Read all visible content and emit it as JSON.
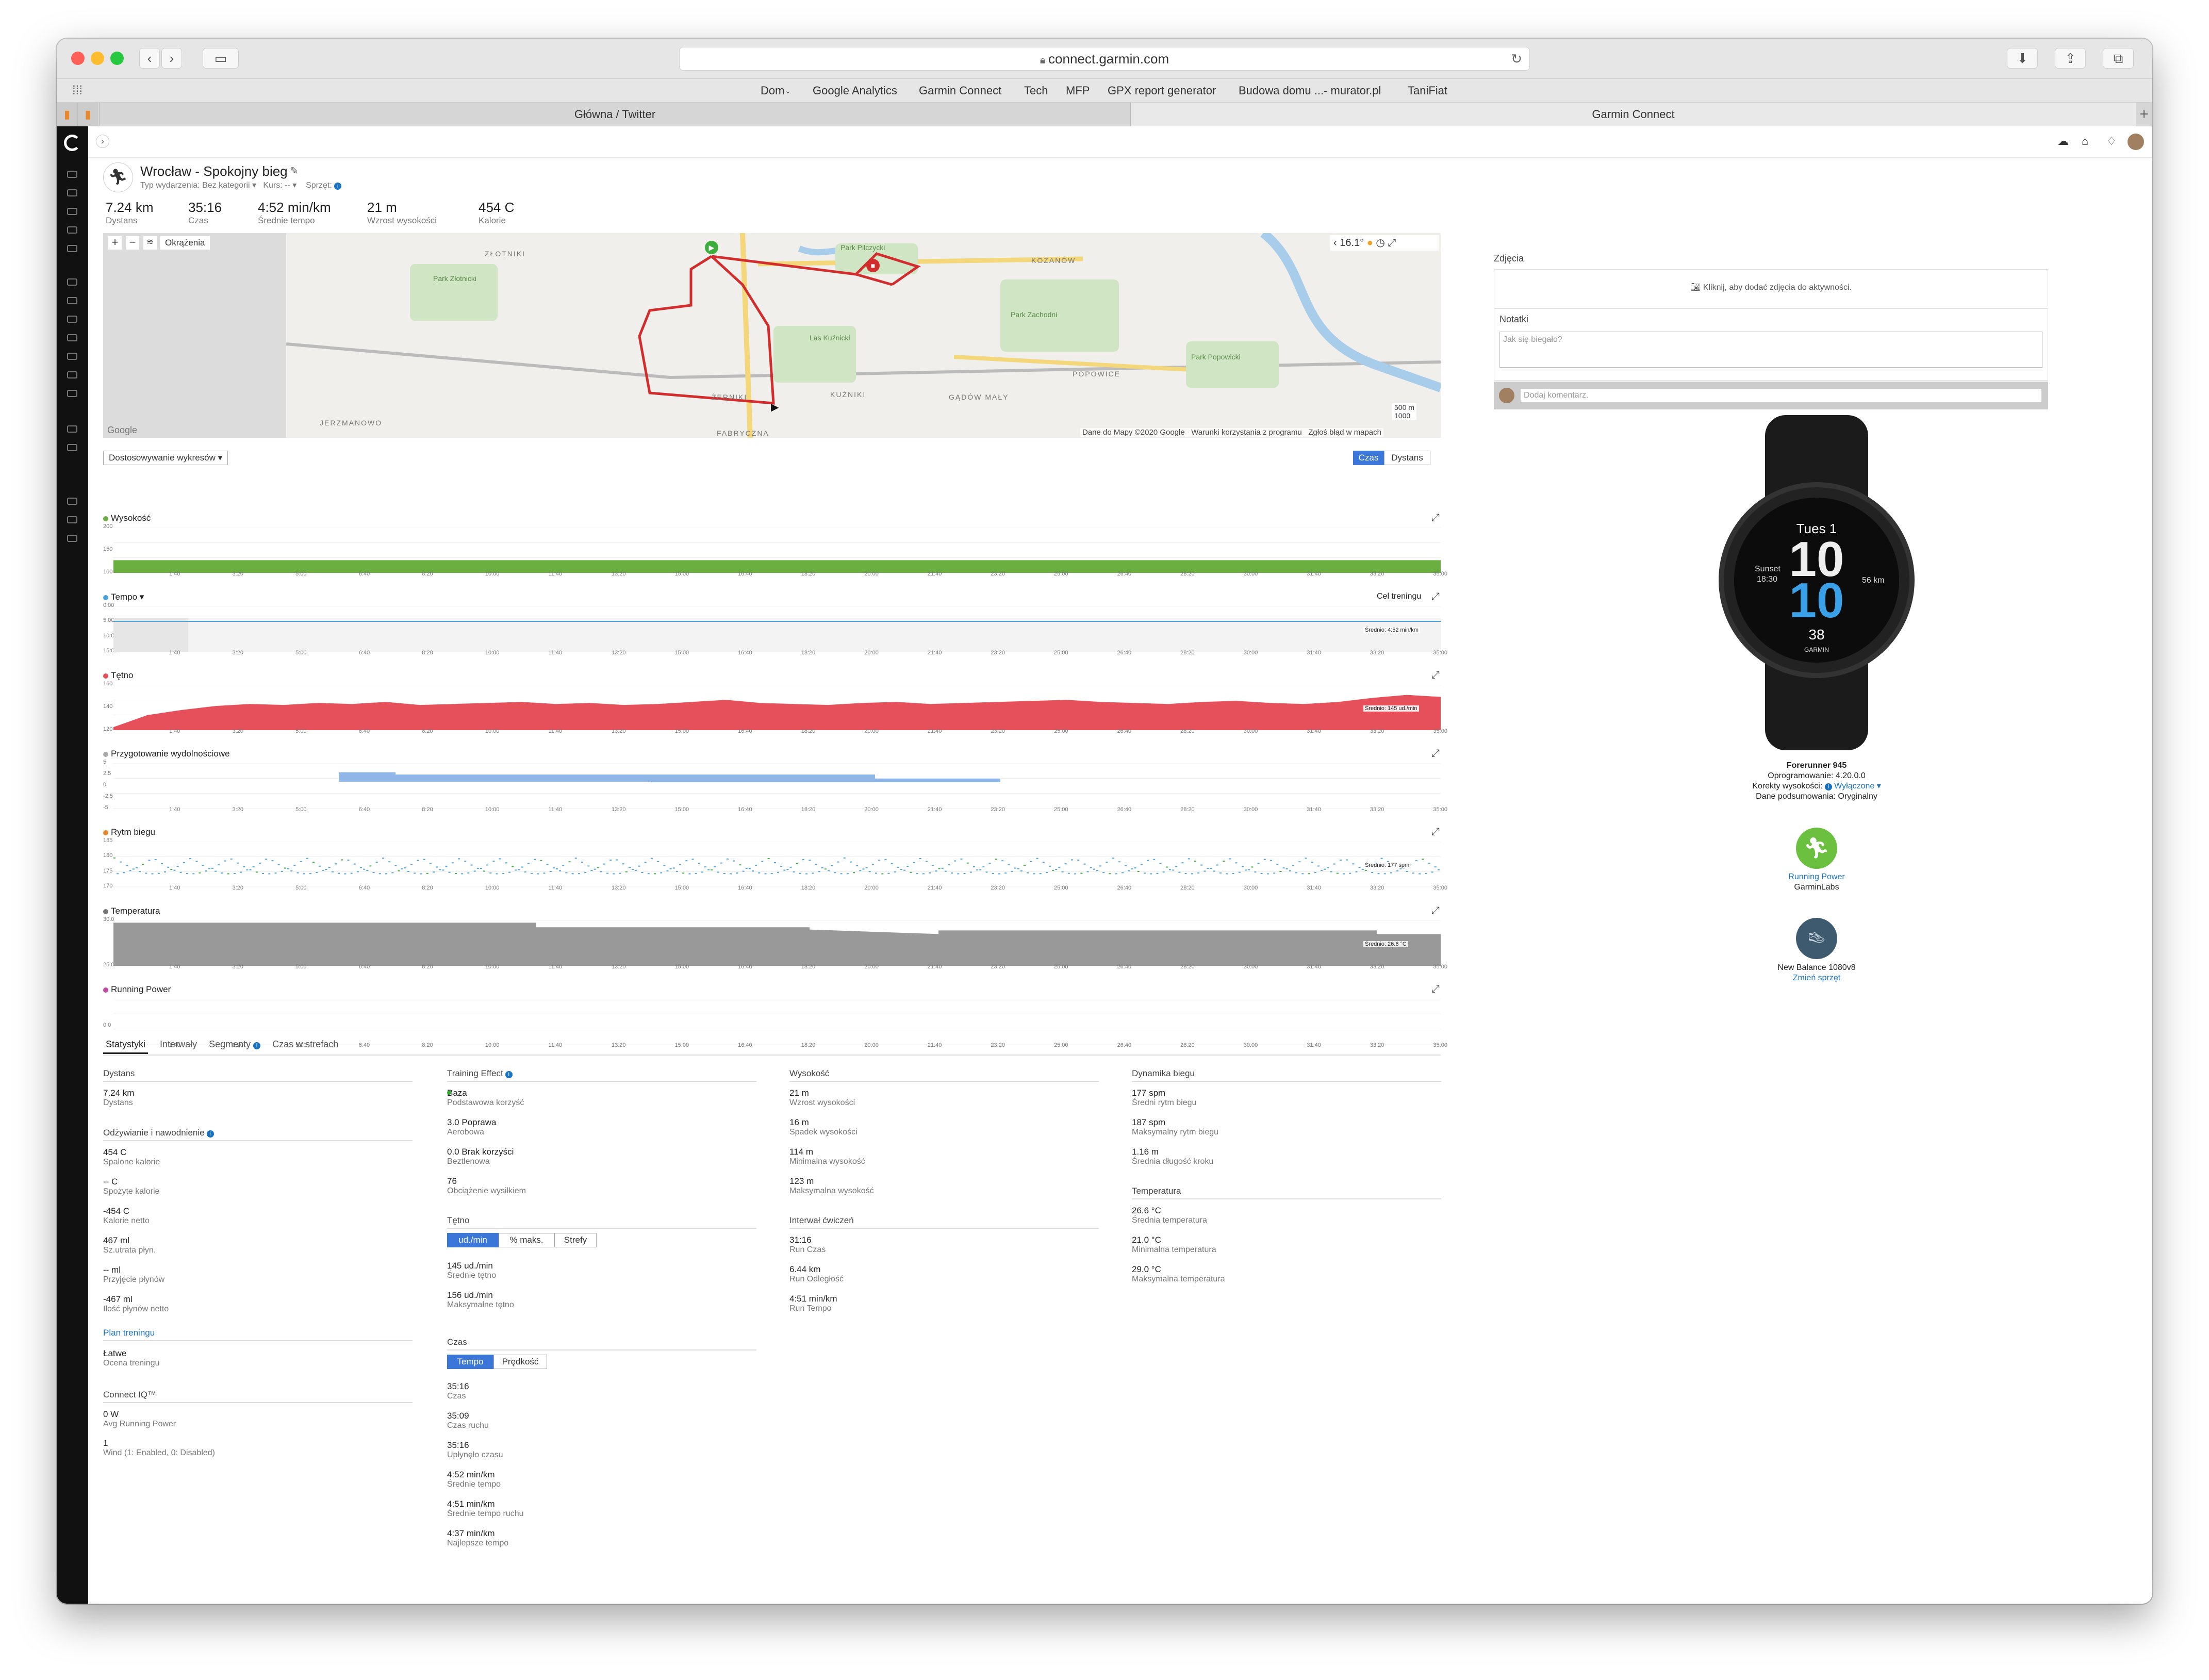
{
  "browser": {
    "url": "connect.garmin.com",
    "bookmarks": [
      "Dom",
      "Google Analytics",
      "Garmin Connect",
      "Tech",
      "MFP",
      "GPX report generator",
      "Budowa domu ...- murator.pl",
      "TaniFiat"
    ],
    "tabs": [
      "Główna / Twitter",
      "Garmin Connect"
    ],
    "new_tab": "+"
  },
  "activity": {
    "title": "Wrocław - Spokojny bieg",
    "meta": {
      "type_label": "Typ wydarzenia:",
      "type_value": "Bez kategorii",
      "course_label": "Kurs:",
      "course_value": "--",
      "gear_label": "Sprzęt:"
    },
    "summary": [
      {
        "value": "7.24 km",
        "label": "Dystans"
      },
      {
        "value": "35:16",
        "label": "Czas"
      },
      {
        "value": "4:52 min/km",
        "label": "Średnie tempo"
      },
      {
        "value": "21 m",
        "label": "Wzrost wysokości"
      },
      {
        "value": "454 C",
        "label": "Kalorie"
      }
    ]
  },
  "map": {
    "fit_button": "Okrążenia",
    "temperature": "16.1°",
    "labels": [
      "ZŁOTNIKI",
      "Park Złotnicki",
      "Park Pilczycki",
      "KOZANÓW",
      "Park Zachodni",
      "Las Kuźnicki",
      "POPOWICE",
      "Park Popowicki",
      "JERZMANOWO",
      "ŻERNIKI",
      "KUŹNIKI",
      "GĄDÓW MAŁY",
      "FABRYCZNA"
    ],
    "scale_m": "500 m",
    "scale_ft": "1000",
    "google": "Google",
    "attribution": [
      "Dane do Mapy ©2020 Google",
      "Warunki korzystania z programu",
      "Zgłoś błąd w mapach"
    ]
  },
  "charts_ui": {
    "customize": "Dostosowywanie wykresów ▾",
    "toggle": [
      "Czas",
      "Dystans"
    ],
    "target": "Cel treningu",
    "x_ticks": [
      "1:40",
      "3:20",
      "5:00",
      "6:40",
      "8:20",
      "10:00",
      "11:40",
      "13:20",
      "15:00",
      "16:40",
      "18:20",
      "20:00",
      "21:40",
      "23:20",
      "25:00",
      "26:40",
      "28:20",
      "30:00",
      "31:40",
      "33:20",
      "35:00"
    ]
  },
  "chart_data": [
    {
      "type": "area",
      "title": "Wysokość",
      "y_ticks": [
        "200",
        "150",
        "100"
      ],
      "ylim": [
        100,
        200
      ],
      "x": [
        0,
        35.27
      ],
      "values": [
        128,
        128
      ]
    },
    {
      "type": "line",
      "title": "Tempo ▾",
      "y_ticks": [
        "0:00",
        "5:00",
        "10:00",
        "15:00"
      ],
      "avg": "Średnio: 4:52 min/km"
    },
    {
      "type": "area",
      "title": "Tętno",
      "y_ticks": [
        "160",
        "140",
        "120"
      ],
      "ylim": [
        120,
        165
      ],
      "avg": "Średnio: 145 ud./min",
      "values": [
        123,
        135,
        140,
        144,
        146,
        145,
        147,
        146,
        148,
        145,
        146,
        147,
        148,
        146,
        147,
        145,
        146,
        148,
        150,
        147,
        146,
        145,
        147,
        148,
        146,
        147,
        148,
        149,
        150,
        148,
        147,
        146,
        148,
        149,
        147,
        146,
        148,
        152,
        155,
        153
      ]
    },
    {
      "type": "bar",
      "title": "Przygotowanie wydolnościowe",
      "y_ticks": [
        "5",
        "2.5",
        "0",
        "-2.5",
        "-5"
      ]
    },
    {
      "type": "scatter",
      "title": "Rytm biegu",
      "y_ticks": [
        "185",
        "180",
        "175",
        "170"
      ],
      "avg": "Średnio: 177 spm"
    },
    {
      "type": "area",
      "title": "Temperatura",
      "y_ticks": [
        "30.0",
        "25.0"
      ],
      "avg": "Średnio: 26.6 °C"
    },
    {
      "type": "line",
      "title": "Running Power",
      "y_ticks": [
        "0.0"
      ]
    }
  ],
  "stats_tabs": [
    "Statystyki",
    "Interwały",
    "Segmenty",
    "Czas w strefach"
  ],
  "stats": {
    "col1": {
      "dystans_hdr": "Dystans",
      "dystans": [
        {
          "v": "7.24 km",
          "l": "Dystans"
        }
      ],
      "nutrition_hdr": "Odżywianie i nawodnienie",
      "nutrition": [
        {
          "v": "454 C",
          "l": "Spalone kalorie"
        },
        {
          "v": "-- C",
          "l": "Spożyte kalorie"
        },
        {
          "v": "-454 C",
          "l": "Kalorie netto"
        },
        {
          "v": "467 ml",
          "l": "Sz.utrata płyn."
        },
        {
          "v": "-- ml",
          "l": "Przyjęcie płynów"
        },
        {
          "v": "-467 ml",
          "l": "Ilość płynów netto"
        }
      ],
      "plan_hdr": "Plan treningu",
      "plan": [
        {
          "v": "Łatwe",
          "l": "Ocena treningu"
        }
      ],
      "iq_hdr": "Connect IQ™",
      "iq": [
        {
          "v": "0 W",
          "l": "Avg Running Power"
        },
        {
          "v": "1",
          "l": "Wind (1: Enabled, 0: Disabled)"
        }
      ]
    },
    "col2": {
      "te_hdr": "Training Effect",
      "te": [
        {
          "v": "Baza",
          "l": "Podstawowa korzyść"
        },
        {
          "v": "3.0 Poprawa",
          "l": "Aerobowa"
        },
        {
          "v": "0.0 Brak korzyści",
          "l": "Beztlenowa"
        },
        {
          "v": "76",
          "l": "Obciążenie wysiłkiem"
        }
      ],
      "hr_hdr": "Tętno",
      "hr_toggle": [
        "ud./min",
        "% maks.",
        "Strefy"
      ],
      "hr": [
        {
          "v": "145 ud./min",
          "l": "Średnie tętno"
        },
        {
          "v": "156 ud./min",
          "l": "Maksymalne tętno"
        }
      ],
      "time_hdr": "Czas",
      "time_toggle": [
        "Tempo",
        "Prędkość"
      ],
      "time": [
        {
          "v": "35:16",
          "l": "Czas"
        },
        {
          "v": "35:09",
          "l": "Czas ruchu"
        },
        {
          "v": "35:16",
          "l": "Upłynęło czasu"
        },
        {
          "v": "4:52 min/km",
          "l": "Średnie tempo"
        },
        {
          "v": "4:51 min/km",
          "l": "Średnie tempo ruchu"
        },
        {
          "v": "4:37 min/km",
          "l": "Najlepsze tempo"
        }
      ]
    },
    "col3": {
      "elev_hdr": "Wysokość",
      "elev": [
        {
          "v": "21 m",
          "l": "Wzrost wysokości"
        },
        {
          "v": "16 m",
          "l": "Spadek wysokości"
        },
        {
          "v": "114 m",
          "l": "Minimalna wysokość"
        },
        {
          "v": "123 m",
          "l": "Maksymalna wysokość"
        }
      ],
      "int_hdr": "Interwał ćwiczeń",
      "int": [
        {
          "v": "31:16",
          "l": "Run Czas"
        },
        {
          "v": "6.44 km",
          "l": "Run Odległość"
        },
        {
          "v": "4:51 min/km",
          "l": "Run Tempo"
        }
      ]
    },
    "col4": {
      "dyn_hdr": "Dynamika biegu",
      "dyn": [
        {
          "v": "177 spm",
          "l": "Średni rytm biegu"
        },
        {
          "v": "187 spm",
          "l": "Maksymalny rytm biegu"
        },
        {
          "v": "1.16 m",
          "l": "Średnia długość kroku"
        }
      ],
      "temp_hdr": "Temperatura",
      "temp": [
        {
          "v": "26.6 °C",
          "l": "Średnia temperatura"
        },
        {
          "v": "21.0 °C",
          "l": "Minimalna temperatura"
        },
        {
          "v": "29.0 °C",
          "l": "Maksymalna temperatura"
        }
      ]
    }
  },
  "right": {
    "photos_hdr": "Zdjęcia",
    "photos_cta": "Kliknij, aby dodać zdjęcia do aktywności.",
    "notes_hdr": "Notatki",
    "notes_placeholder": "Jak się biegało?",
    "comment_placeholder": "Dodaj komentarz.",
    "watch_face": {
      "date": "Tues 1",
      "hour": "10",
      "minute": "10",
      "sunset": "Sunset",
      "sunset_time": "18:30",
      "km": "56 km",
      "seconds": "38",
      "brand": "GARMIN"
    },
    "device_name": "Forerunner 945",
    "firmware": "Oprogramowanie: 4.20.0.0",
    "elev_corr_label": "Korekty wysokości:",
    "elev_corr_value": "Wyłączone ▾",
    "summary_data": "Dane podsumowania: Oryginalny",
    "app_name": "Running Power",
    "app_dev": "GarminLabs",
    "shoe_name": "New Balance 1080v8",
    "shoe_change": "Zmień sprzęt"
  },
  "colors": {
    "elevation": "#6aaf3f",
    "heart": "#e5505a",
    "temp": "#999999",
    "accent": "#1a72c2",
    "route": "#d22d2d"
  }
}
